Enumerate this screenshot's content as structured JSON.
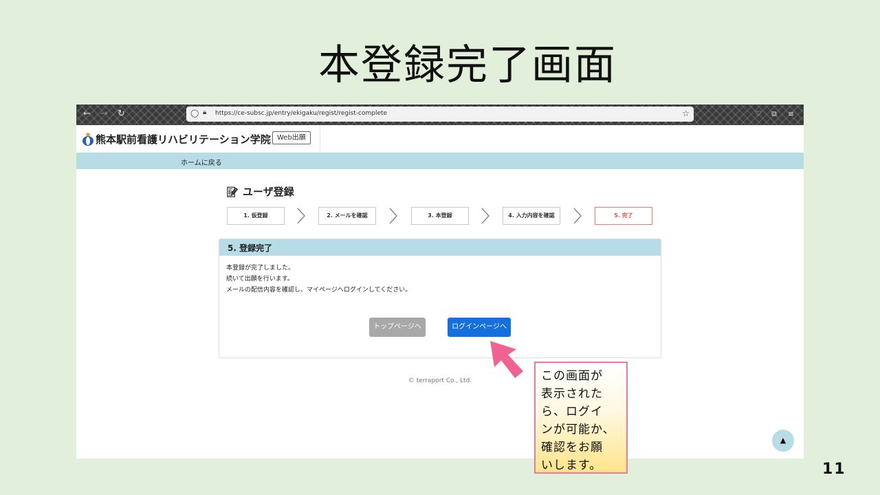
{
  "slide": {
    "title": "本登録完了画面",
    "page_number": "11"
  },
  "browser": {
    "url": "https://ce-subsc.jp/entry/ekigaku/regist/regist-complete",
    "back_icon": "←",
    "forward_icon": "→",
    "reload_icon": "↻"
  },
  "site": {
    "school_name": "熊本駅前看護リハビリテーション学院",
    "web_badge": "Web出願",
    "nav_home": "ホームに戻る",
    "page_heading": "ユーザ登録",
    "steps": [
      {
        "label": "1. 仮登録"
      },
      {
        "label": "2. メールを確認"
      },
      {
        "label": "3. 本登録"
      },
      {
        "label": "4. 入力内容を確認"
      },
      {
        "label": "5. 完了"
      }
    ],
    "panel": {
      "title": "5. 登録完了",
      "line1": "本登録が完了しました。",
      "line2": "続いて出願を行います。",
      "line3": "メールの配信内容を確認し、マイページへログインしてください。",
      "top_button": "トップページへ",
      "login_button": "ログインページへ"
    },
    "footer": "© terraport Co., Ltd.",
    "scroll_top_icon": "▲"
  },
  "callout": {
    "text": "この画面が\n表示された\nら、ログイ\nンが可能か、\n確認をお願\nいします。"
  },
  "colors": {
    "slide_bg": "#e2efda",
    "accent_band": "#b7dce6",
    "primary_button": "#1570dc",
    "active_step": "#d9534f",
    "arrow": "#f06292"
  }
}
